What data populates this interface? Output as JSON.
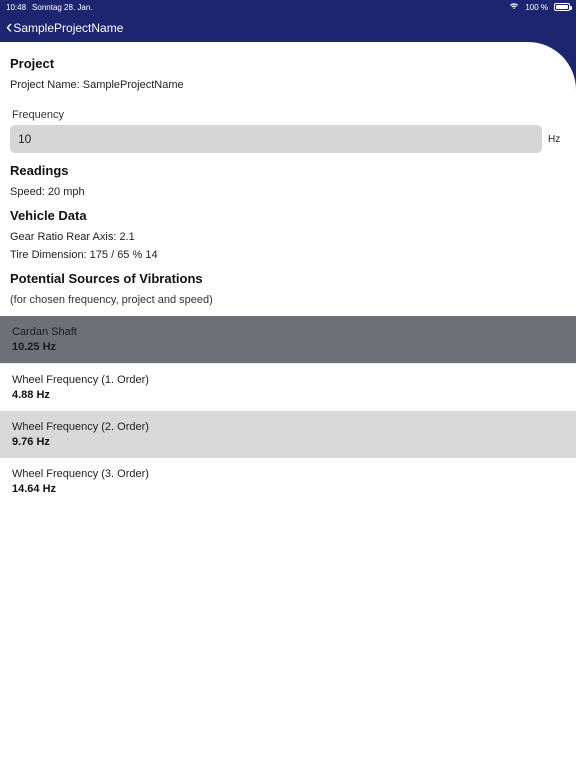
{
  "status": {
    "time": "10:48",
    "date": "Sonntag 28. Jan.",
    "battery": "100 %"
  },
  "nav": {
    "back_label": "SampleProjectName"
  },
  "sections": {
    "project": {
      "heading": "Project",
      "name_label": "Project Name: ",
      "name_value": "SampleProjectName"
    },
    "readings": {
      "heading": "Readings",
      "speed_label": "Speed: ",
      "speed_value": "20 mph"
    },
    "vehicle": {
      "heading": "Vehicle Data",
      "gear_label": "Gear Ratio Rear Axis: ",
      "gear_value": "2.1",
      "tire_label": "Tire Dimension: ",
      "tire_value": "175 / 65 % 14"
    },
    "sources": {
      "heading": "Potential Sources of Vibrations",
      "sub": "(for chosen frequency, project and speed)"
    }
  },
  "frequency": {
    "label": "Frequency",
    "value": "10",
    "unit": "Hz"
  },
  "sources": [
    {
      "name": "Cardan Shaft",
      "value": "10.25 Hz"
    },
    {
      "name": "Wheel Frequency (1. Order)",
      "value": "4.88 Hz"
    },
    {
      "name": "Wheel Frequency (2. Order)",
      "value": "9.76 Hz"
    },
    {
      "name": "Wheel Frequency (3. Order)",
      "value": "14.64 Hz"
    }
  ]
}
